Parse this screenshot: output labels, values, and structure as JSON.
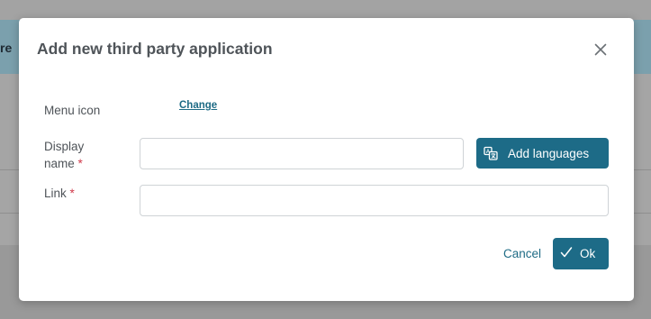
{
  "background": {
    "banner_text": "re"
  },
  "modal": {
    "title": "Add new third party application",
    "close_icon": "close-icon",
    "menu_icon": {
      "label": "Menu icon",
      "change_link": "Change"
    },
    "display_name": {
      "label_line1": "Display",
      "label_line2": "name",
      "required_marker": "*",
      "value": "",
      "placeholder": ""
    },
    "add_languages": {
      "label": "Add languages",
      "icon": "translate-icon"
    },
    "link": {
      "label": "Link",
      "required_marker": "*",
      "value": "",
      "placeholder": ""
    },
    "footer": {
      "cancel_label": "Cancel",
      "ok_label": "Ok",
      "ok_icon": "check-icon"
    }
  },
  "colors": {
    "primary": "#1d6b87",
    "link": "#1e6b85",
    "required": "#d0394a",
    "text": "#4f5459"
  }
}
